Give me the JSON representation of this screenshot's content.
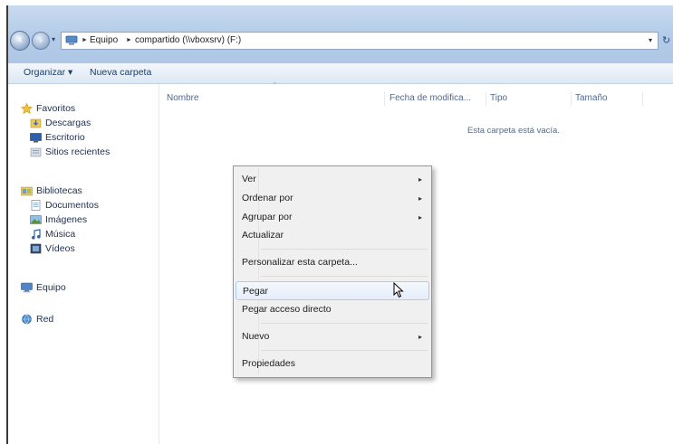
{
  "window": {
    "nav": {
      "back_glyph": "‹",
      "forward_glyph": "›",
      "history_glyph": "▾"
    },
    "address": {
      "separator": "►",
      "crumbs": [
        "Equipo",
        "compartido (\\\\vboxsrv) (F:)"
      ],
      "dropdown_glyph": "▾",
      "refresh_glyph": "↻"
    },
    "toolbar": {
      "organize_label": "Organizar ▾",
      "new_folder_label": "Nueva carpeta"
    },
    "sidebar": {
      "items": [
        {
          "label": "Favoritos",
          "icon": "star-icon",
          "level": 0
        },
        {
          "label": "Descargas",
          "icon": "downloads-icon",
          "level": 1
        },
        {
          "label": "Escritorio",
          "icon": "desktop-icon",
          "level": 1
        },
        {
          "label": "Sitios recientes",
          "icon": "recent-places-icon",
          "level": 1
        },
        {
          "label": "Bibliotecas",
          "icon": "libraries-icon",
          "level": 0
        },
        {
          "label": "Documentos",
          "icon": "documents-icon",
          "level": 1
        },
        {
          "label": "Imágenes",
          "icon": "pictures-icon",
          "level": 1
        },
        {
          "label": "Música",
          "icon": "music-icon",
          "level": 1
        },
        {
          "label": "Vídeos",
          "icon": "videos-icon",
          "level": 1
        },
        {
          "label": "Equipo",
          "icon": "computer-icon",
          "level": 0
        },
        {
          "label": "Red",
          "icon": "network-icon",
          "level": 0
        }
      ]
    },
    "content": {
      "columns": [
        "Nombre",
        "Fecha de modifica...",
        "Tipo",
        "Tamaño"
      ],
      "sort_glyph": "^",
      "empty_message": "Esta carpeta está vacía."
    },
    "context_menu": {
      "submenu_glyph": "▸",
      "items": [
        {
          "label": "Ver",
          "submenu": true
        },
        {
          "label": "Ordenar por",
          "submenu": true
        },
        {
          "label": "Agrupar por",
          "submenu": true
        },
        {
          "label": "Actualizar",
          "submenu": false
        },
        {
          "label": "Personalizar esta carpeta...",
          "submenu": false
        },
        {
          "label": "Pegar",
          "submenu": false,
          "highlighted": true
        },
        {
          "label": "Pegar acceso directo",
          "submenu": false
        },
        {
          "label": "Nuevo",
          "submenu": true
        },
        {
          "label": "Propiedades",
          "submenu": false
        }
      ]
    }
  },
  "colors": {
    "frame": "#b9cfea",
    "link_text": "#1e3d66",
    "menu_background": "#f0f0f0",
    "menu_highlight_border": "#aecaf0"
  }
}
